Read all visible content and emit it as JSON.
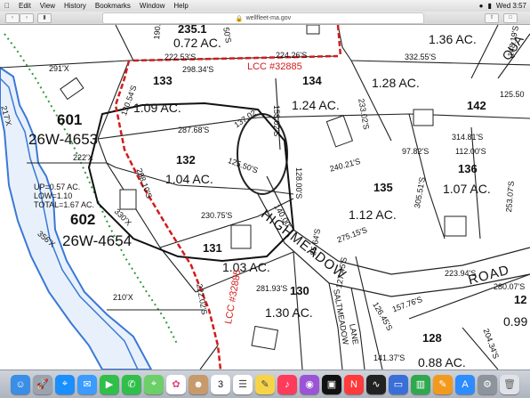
{
  "menubar": {
    "items": [
      "Edit",
      "View",
      "History",
      "Bookmarks",
      "Window",
      "Help"
    ],
    "clock": "Wed 3:57",
    "apple_glyph": "apple-icon"
  },
  "toolbar": {
    "url": "wellfleet-ma.gov"
  },
  "map": {
    "parcels": [
      {
        "lot": "235.1",
        "acres": "0.72 AC."
      },
      {
        "lot": "133",
        "acres": "1.09 AC."
      },
      {
        "lot": "134",
        "acres": "1.24 AC."
      },
      {
        "lot": "142",
        "acres": "1.28 AC."
      },
      {
        "lot": "601",
        "acres": "26W-4653"
      },
      {
        "lot": "132",
        "acres": "1.04 AC."
      },
      {
        "lot": "135",
        "acres": "1.12 AC."
      },
      {
        "lot": "136",
        "acres": "1.07 AC."
      },
      {
        "lot": "602",
        "acres": "26W-4654"
      },
      {
        "lot": "131",
        "acres": "1.03 AC."
      },
      {
        "lot": "130",
        "acres": "1.30 AC."
      },
      {
        "lot": "128",
        "acres": "0.88 AC."
      }
    ],
    "acres_136_right": "1.36 AC.",
    "acres_137": "0.99 AC",
    "lot_12": "12",
    "lcc_top": "LCC #32885",
    "lcc_bottom": "LCC #32885",
    "road_highmeadow": "HIGHMEADOW",
    "road_road": "ROAD",
    "road_saltmeadow": "SALTMEADOW",
    "road_lane": "LANE",
    "road_qua": "QUA",
    "area_info": {
      "up": "UP=0.57 AC.",
      "low": "LOW=1.10",
      "total": "TOTAL=1.67 AC."
    },
    "dims": [
      "190.9",
      "222.53'S",
      "224.26'S",
      "298.34'S",
      "291'X",
      "130.54'S",
      "158.02'S",
      "332.55'S",
      "148.19'S",
      "125.50",
      "233.02'S",
      "287.68'S",
      "137.02'",
      "314.81'S",
      "112.00'S",
      "222'X",
      "125.50'S",
      "97.82'S",
      "240.21'S",
      "298.10'S",
      "128.00'S",
      "330'X",
      "230.75'S",
      "305.51'S",
      "253.07'S",
      "275.15'S",
      "140.00'",
      "85.64'S",
      "223.94'S",
      "280.07'S",
      "222.02'S",
      "281.93'S",
      "127.45'S",
      "157.76'S",
      "126.45'S",
      "204.34'S",
      "141.37'S",
      "210'X",
      "217'X",
      "356'X",
      "50'S"
    ]
  },
  "dock": {
    "apps": [
      "finder-icon",
      "launchpad-icon",
      "safari-icon",
      "mail-icon",
      "facetime-icon",
      "messages-icon",
      "maps-icon",
      "photos-icon",
      "contacts-icon",
      "calendar-icon",
      "reminders-icon",
      "notes-icon",
      "music-icon",
      "podcasts-icon",
      "tv-icon",
      "news-icon",
      "stocks-icon",
      "keynote-icon",
      "numbers-icon",
      "pages-icon",
      "appstore-icon",
      "settings-icon",
      "trash-icon"
    ],
    "calendar_day": "3"
  }
}
